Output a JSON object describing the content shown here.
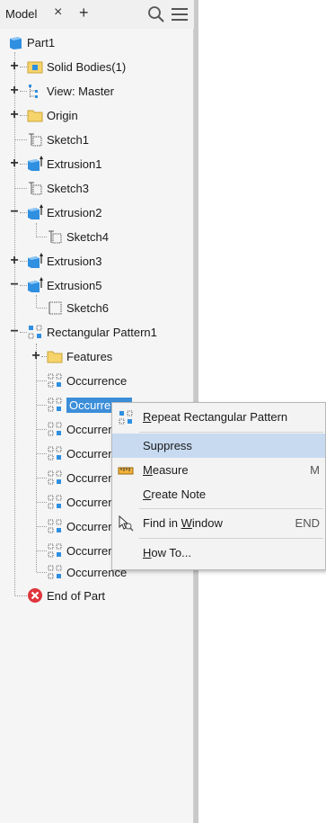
{
  "tabs": {
    "label": "Model",
    "close_glyph": "×",
    "add_glyph": "+"
  },
  "header_icons": [
    "search-icon",
    "menu-icon"
  ],
  "tree": {
    "root": "Part1",
    "items": [
      {
        "label": "Solid Bodies(1)",
        "icon": "folder-solid-bodies-icon"
      },
      {
        "label": "View: Master",
        "icon": "view-icon"
      },
      {
        "label": "Origin",
        "icon": "folder-icon"
      },
      {
        "label": "Sketch1",
        "icon": "sketch-icon"
      },
      {
        "label": "Extrusion1",
        "icon": "extrusion-icon"
      },
      {
        "label": "Sketch3",
        "icon": "sketch-icon"
      },
      {
        "label": "Extrusion2",
        "icon": "extrusion-icon"
      },
      {
        "label": "Sketch4",
        "icon": "sketch-icon"
      },
      {
        "label": "Extrusion3",
        "icon": "extrusion-icon"
      },
      {
        "label": "Extrusion5",
        "icon": "extrusion-icon"
      },
      {
        "label": "Sketch6",
        "icon": "sketch-icon"
      },
      {
        "label": "Rectangular Pattern1",
        "icon": "pattern-icon"
      },
      {
        "label": "Features",
        "icon": "folder-icon"
      },
      {
        "label": "Occurrence",
        "icon": "occurrence-icon"
      },
      {
        "label": "Occurrence",
        "icon": "occurrence-icon"
      },
      {
        "label": "Occurrence",
        "icon": "occurrence-icon"
      },
      {
        "label": "Occurrence",
        "icon": "occurrence-icon"
      },
      {
        "label": "Occurrence",
        "icon": "occurrence-icon"
      },
      {
        "label": "Occurrence",
        "icon": "occurrence-icon"
      },
      {
        "label": "Occurrence",
        "icon": "occurrence-icon"
      },
      {
        "label": "Occurrence",
        "icon": "occurrence-icon"
      },
      {
        "label": "Occurrence",
        "icon": "occurrence-icon"
      },
      {
        "label": "End of Part",
        "icon": "end-of-part-icon"
      }
    ],
    "selected_label": "Occurrence"
  },
  "context_menu": {
    "items": [
      {
        "text": "Repeat Rectangular Pattern",
        "underline": "R",
        "rest": "epeat Rectangular Pattern",
        "shortcut": "",
        "icon": "pattern-icon"
      },
      {
        "text": "Suppress",
        "shortcut": "",
        "icon": ""
      },
      {
        "text": "Measure",
        "underline": "M",
        "rest": "easure",
        "shortcut": "M",
        "icon": "measure-icon"
      },
      {
        "text": "Create Note",
        "underline": "C",
        "rest": "reate Note",
        "shortcut": "",
        "icon": ""
      },
      {
        "text": "Find in Window",
        "pre": "Find in ",
        "underline": "W",
        "rest": "indow",
        "shortcut": "END",
        "icon": "find-in-window-icon"
      },
      {
        "text": "How To...",
        "underline": "H",
        "rest": "ow To...",
        "shortcut": "",
        "icon": ""
      }
    ]
  },
  "colors": {
    "selection": "#3c8ed9",
    "highlight": "#c7daf0",
    "folder": "#f7d36b",
    "extrusion": "#2f8fe0",
    "error": "#e0353c"
  }
}
